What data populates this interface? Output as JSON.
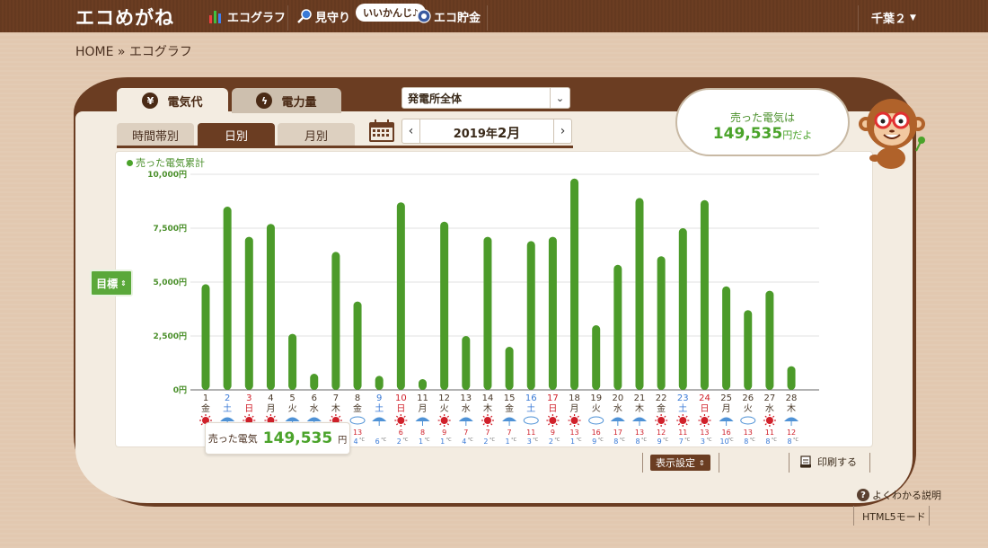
{
  "header": {
    "logo": "エコめがね",
    "nav": [
      {
        "label": "エコグラフ",
        "icon": "bar-graph-icon"
      },
      {
        "label": "見守り",
        "icon": "magnifier-icon"
      },
      {
        "label": "エコ貯金",
        "icon": "coin-icon"
      }
    ],
    "bubble": "いいかんじ♪",
    "user": "千葉２"
  },
  "breadcrumb": "HOME » エコグラフ",
  "tabs_top": [
    {
      "label": "電気代",
      "icon": "yen-icon"
    },
    {
      "label": "電力量",
      "icon": "lightning-icon"
    }
  ],
  "plant_select": "発電所全体",
  "tabs_sub": [
    "時間帯別",
    "日別",
    "月別"
  ],
  "date_nav": {
    "year": "2019年",
    "month": "2月",
    "prev": "‹",
    "next": "›"
  },
  "legend_label": "売った電気累計",
  "target_button": "目標",
  "sold_total": {
    "label": "売った電気",
    "value": "149,535",
    "unit": "円"
  },
  "speech": {
    "line1": "売った電気は",
    "value": "149,535",
    "suffix": "円だよ"
  },
  "display_settings": "表示設定",
  "print": "印刷する",
  "help": "よくわかる説明",
  "html5_mode": "HTML5モード",
  "colors": {
    "brown": "#6b3d22",
    "green": "#4aa32a",
    "bar": "#4c9b2a",
    "sun": "#d0202a",
    "rain": "#4f92d6",
    "sat": "#3a7ad6",
    "sun_day": "#d0202a"
  },
  "chart_data": {
    "type": "bar",
    "ylim": [
      0,
      10000
    ],
    "yticks": [
      "0円",
      "2,500円",
      "5,000円",
      "7,500円",
      "10,000円"
    ],
    "categories": [
      "1",
      "2",
      "3",
      "4",
      "5",
      "6",
      "7",
      "8",
      "9",
      "10",
      "11",
      "12",
      "13",
      "14",
      "15",
      "16",
      "17",
      "18",
      "19",
      "20",
      "21",
      "22",
      "23",
      "24",
      "25",
      "26",
      "27",
      "28"
    ],
    "weekdays": [
      "金",
      "土",
      "日",
      "月",
      "火",
      "水",
      "木",
      "金",
      "土",
      "日",
      "月",
      "火",
      "水",
      "木",
      "金",
      "土",
      "日",
      "月",
      "火",
      "水",
      "木",
      "金",
      "土",
      "日",
      "月",
      "火",
      "水",
      "木"
    ],
    "values": [
      4900,
      8500,
      7100,
      7700,
      2600,
      750,
      6400,
      4100,
      650,
      8700,
      500,
      7800,
      2500,
      7100,
      2000,
      6900,
      7100,
      9800,
      3000,
      5800,
      8900,
      6200,
      7500,
      8800,
      4800,
      3700,
      4600,
      1100
    ],
    "weather": [
      "sun",
      "rain",
      "sun",
      "sun",
      "rain",
      "rain",
      "sun",
      "cloud",
      "rain",
      "sun",
      "rain",
      "sun",
      "rain",
      "sun",
      "rain",
      "cloud",
      "sun",
      "sun",
      "cloud",
      "rain",
      "rain",
      "sun",
      "sun",
      "sun",
      "rain",
      "cloud",
      "sun",
      "rain"
    ],
    "temp_high": [
      "",
      "",
      "",
      "",
      "",
      "",
      "",
      "13",
      "",
      "6",
      "8",
      "9",
      "7",
      "7",
      "7",
      "11",
      "9",
      "13",
      "16",
      "17",
      "13",
      "12",
      "11",
      "13",
      "16",
      "13",
      "11",
      "12"
    ],
    "temp_low": [
      "",
      "",
      "",
      "",
      "",
      "",
      "",
      "4",
      "6",
      "2",
      "1",
      "1",
      "4",
      "2",
      "1",
      "3",
      "2",
      "1",
      "9",
      "8",
      "8",
      "9",
      "7",
      "3",
      "10",
      "8",
      "8",
      "8"
    ]
  }
}
